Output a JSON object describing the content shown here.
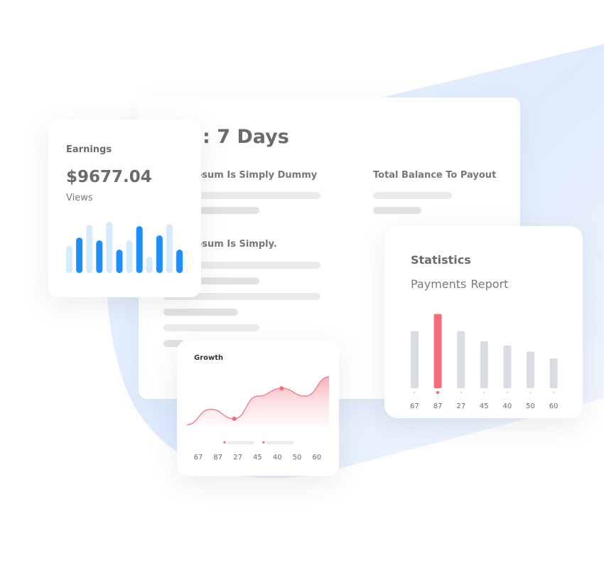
{
  "report": {
    "title": ": 7 Days",
    "heading_1": "psum Is Simply Dummy",
    "heading_2": "Total Balance To Payout",
    "heading_3": "psum Is Simply."
  },
  "earnings": {
    "label": "Earnings",
    "amount": "$9677.04",
    "views_label": "Views"
  },
  "growth": {
    "label": "Growth",
    "ticks": [
      "67",
      "87",
      "27",
      "45",
      "40",
      "50",
      "60"
    ]
  },
  "statistics": {
    "title": "Statistics",
    "subtitle_1": "Payments",
    "subtitle_2": "Report"
  },
  "colors": {
    "blue": "#1e8ff9",
    "light_blue": "#d6eafd",
    "red": "#f56b7a",
    "gray_bar": "#d8dde3"
  },
  "chart_data": [
    {
      "type": "bar",
      "name_in_ui": "Earnings mini chart",
      "values": [
        38,
        50,
        68,
        46,
        72,
        33,
        46,
        66,
        23,
        53,
        69,
        33
      ],
      "highlight": [
        false,
        true,
        false,
        true,
        false,
        true,
        false,
        true,
        false,
        true,
        false,
        true
      ]
    },
    {
      "type": "area",
      "name_in_ui": "Growth",
      "categories": [
        "67",
        "87",
        "27",
        "45",
        "40",
        "50",
        "60"
      ],
      "values": [
        2,
        28,
        12,
        50,
        63,
        50,
        82
      ],
      "markers": [
        2,
        4
      ]
    },
    {
      "type": "bar",
      "name_in_ui": "Statistics",
      "categories": [
        "67",
        "87",
        "27",
        "45",
        "40",
        "50",
        "60"
      ],
      "values": [
        67,
        87,
        67,
        55,
        50,
        43,
        35
      ],
      "highlight_index": 1
    }
  ]
}
